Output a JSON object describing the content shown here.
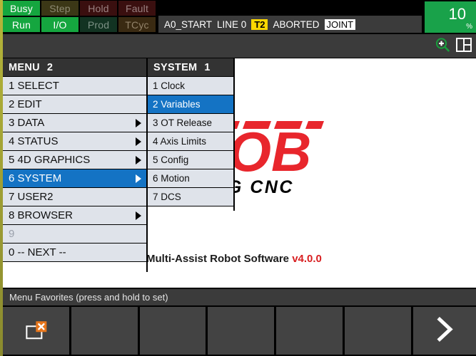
{
  "statusbar": {
    "indicators_row1": [
      {
        "label": "Busy",
        "state": "on-green"
      },
      {
        "label": "Step",
        "state": "off-olive"
      },
      {
        "label": "Hold",
        "state": "off-red"
      },
      {
        "label": "Fault",
        "state": "off-red"
      }
    ],
    "indicators_row2": [
      {
        "label": "Run",
        "state": "on-green"
      },
      {
        "label": "I/O",
        "state": "on-green"
      },
      {
        "label": "Prod",
        "state": "off-green"
      },
      {
        "label": "TCyc",
        "state": "off-brown"
      }
    ],
    "program": "A0_START",
    "line_label": "LINE 0",
    "mode_tag": "T2",
    "run_state": "ABORTED",
    "coord_frame": "JOINT",
    "override_value": "10",
    "override_unit": "%",
    "colors": {
      "active_green": "#15a63f",
      "override_green": "#19a24a",
      "mode_tag_yellow": "#ffd800",
      "bar_gray": "#3b3b3b"
    }
  },
  "toolbar": {
    "icons": [
      {
        "name": "zoom-in-icon",
        "title": "Zoom In"
      },
      {
        "name": "window-layout-icon",
        "title": "Layout"
      }
    ]
  },
  "menu": {
    "header_title": "MENU",
    "header_index": "2",
    "items": [
      {
        "label": "1 SELECT",
        "arrow": false,
        "selected": false,
        "disabled": false
      },
      {
        "label": "2 EDIT",
        "arrow": false,
        "selected": false,
        "disabled": false
      },
      {
        "label": "3 DATA",
        "arrow": true,
        "selected": false,
        "disabled": false
      },
      {
        "label": "4 STATUS",
        "arrow": true,
        "selected": false,
        "disabled": false
      },
      {
        "label": "5 4D GRAPHICS",
        "arrow": true,
        "selected": false,
        "disabled": false
      },
      {
        "label": "6 SYSTEM",
        "arrow": true,
        "selected": true,
        "disabled": false
      },
      {
        "label": "7 USER2",
        "arrow": false,
        "selected": false,
        "disabled": false
      },
      {
        "label": "8 BROWSER",
        "arrow": true,
        "selected": false,
        "disabled": false
      },
      {
        "label": "9",
        "arrow": false,
        "selected": false,
        "disabled": true
      },
      {
        "label": "0 -- NEXT --",
        "arrow": false,
        "selected": false,
        "disabled": false
      }
    ]
  },
  "submenu": {
    "header_title": "SYSTEM",
    "header_index": "1",
    "items": [
      {
        "label": "1 Clock",
        "selected": false
      },
      {
        "label": "2 Variables",
        "selected": true
      },
      {
        "label": "3 OT Release",
        "selected": false
      },
      {
        "label": "4 Axis Limits",
        "selected": false
      },
      {
        "label": "5 Config",
        "selected": false
      },
      {
        "label": "6 Motion",
        "selected": false
      },
      {
        "label": "7 DCS",
        "selected": false
      }
    ]
  },
  "main": {
    "logo_text_primary": "JOB",
    "logo_text_prefix": "O",
    "logo_tagline": "OTIZING CNC",
    "logo_color": "#e8262c",
    "software_name": "Multi-Assist Robot Software",
    "software_version": "v4.0.0"
  },
  "favorites": {
    "label": "Menu Favorites (press and hold to set)",
    "buttons": [
      {
        "name": "close-window-button",
        "icon": "close-window-icon"
      },
      {
        "name": "fav-slot-2",
        "icon": ""
      },
      {
        "name": "fav-slot-3",
        "icon": ""
      },
      {
        "name": "fav-slot-4",
        "icon": ""
      },
      {
        "name": "fav-slot-5",
        "icon": ""
      },
      {
        "name": "fav-slot-6",
        "icon": ""
      },
      {
        "name": "next-page-button",
        "icon": "chevron-right-icon"
      }
    ]
  }
}
